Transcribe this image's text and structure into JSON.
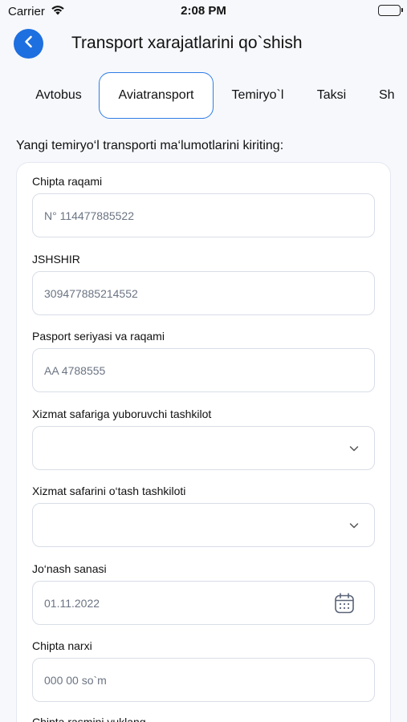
{
  "status_bar": {
    "carrier": "Carrier",
    "time": "2:08 PM",
    "wifi_icon": "wifi-icon",
    "battery_icon": "battery-icon"
  },
  "header": {
    "title": "Transport xarajatlarini qo`shish",
    "back_icon": "chevron-left-icon",
    "accent_color": "#1e6fe0"
  },
  "tabs": [
    {
      "label": "Avtobus",
      "active": false
    },
    {
      "label": "Aviatransport",
      "active": true
    },
    {
      "label": "Temiryo`l",
      "active": false
    },
    {
      "label": "Taksi",
      "active": false
    },
    {
      "label": "Sh",
      "active": false
    }
  ],
  "intro_text": "Yangi temiryo‘l transporti ma‘lumotlarini kiriting:",
  "form": {
    "ticket_number": {
      "label": "Chipta raqami",
      "value": "N° 114477885522"
    },
    "jshshir": {
      "label": "JSHSHIR",
      "value": "309477885214552"
    },
    "passport": {
      "label": "Pasport seriyasi va raqami",
      "value": "AA 4788555"
    },
    "sending_org": {
      "label": "Xizmat safariga yuboruvchi tashkilot",
      "value": ""
    },
    "hosting_org": {
      "label": "Xizmat safarini o‘tash tashkiloti",
      "value": ""
    },
    "departure_date": {
      "label": "Jo‘nash sanasi",
      "value": "01.11.2022"
    },
    "ticket_price": {
      "label": "Chipta narxi",
      "value": "000 00 so`m"
    },
    "ticket_image": {
      "label": "Chipta rasmini yuklang"
    }
  }
}
